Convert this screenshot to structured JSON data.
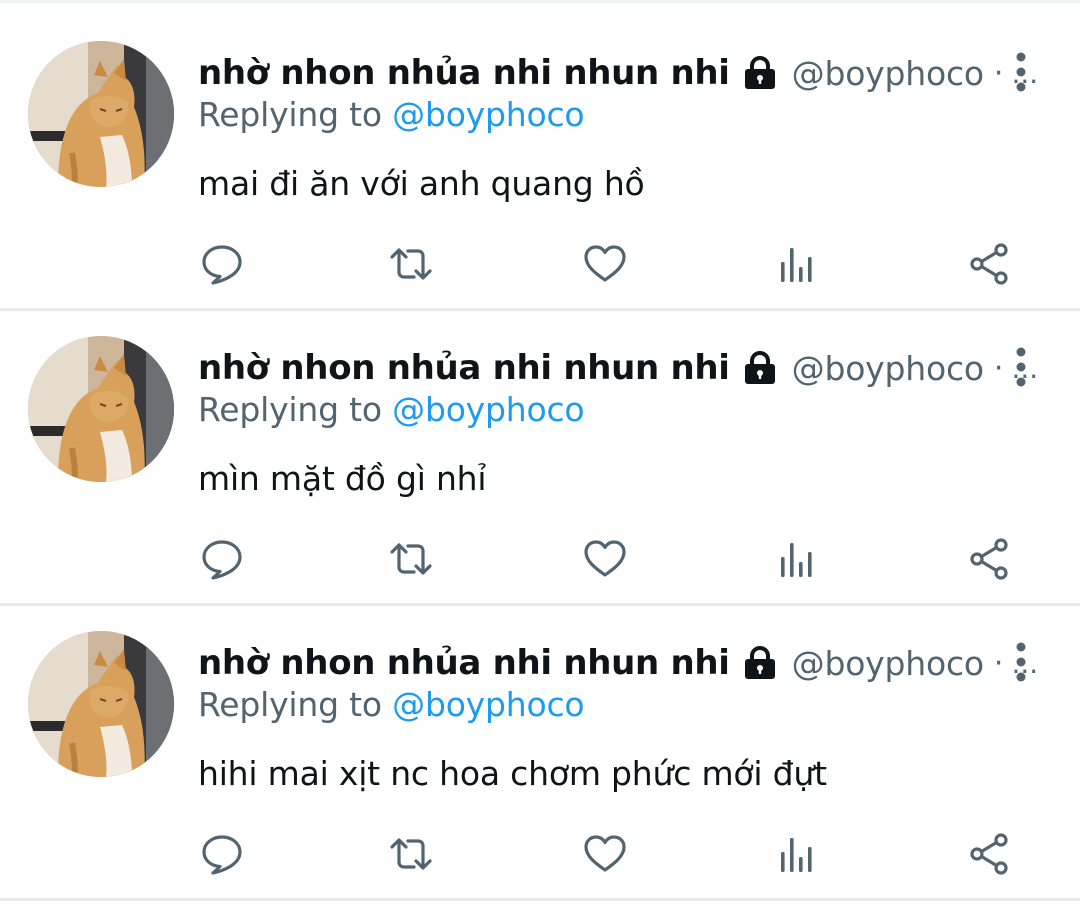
{
  "tweets": [
    {
      "display_name": "nhờ nhon nhủa nhi nhun nhi",
      "handle": "@boyphoco",
      "separator": "·",
      "overflow": "...",
      "reply_prefix": "Replying to ",
      "reply_to": "@boyphoco",
      "text": "mai đi ăn với anh quang hồ"
    },
    {
      "display_name": "nhờ nhon nhủa nhi nhun nhi",
      "handle": "@boyphoco",
      "separator": "·",
      "overflow": "...",
      "reply_prefix": "Replying to ",
      "reply_to": "@boyphoco",
      "text": "mìn mặt đồ gì nhỉ"
    },
    {
      "display_name": "nhờ nhon nhủa nhi nhun nhi",
      "handle": "@boyphoco",
      "separator": "·",
      "overflow": "...",
      "reply_prefix": "Replying to ",
      "reply_to": "@boyphoco",
      "text": "hihi mai xịt nc hoa chơm phức mới đựt"
    }
  ],
  "icons": {
    "lock": "lock-icon",
    "more": "more-vertical-icon",
    "reply": "reply-icon",
    "retweet": "retweet-icon",
    "like": "heart-icon",
    "views": "views-chart-icon",
    "share": "share-icon"
  },
  "colors": {
    "text": "#0f1419",
    "secondary": "#536471",
    "link": "#1d9bf0",
    "divider": "#e8eaeb"
  }
}
